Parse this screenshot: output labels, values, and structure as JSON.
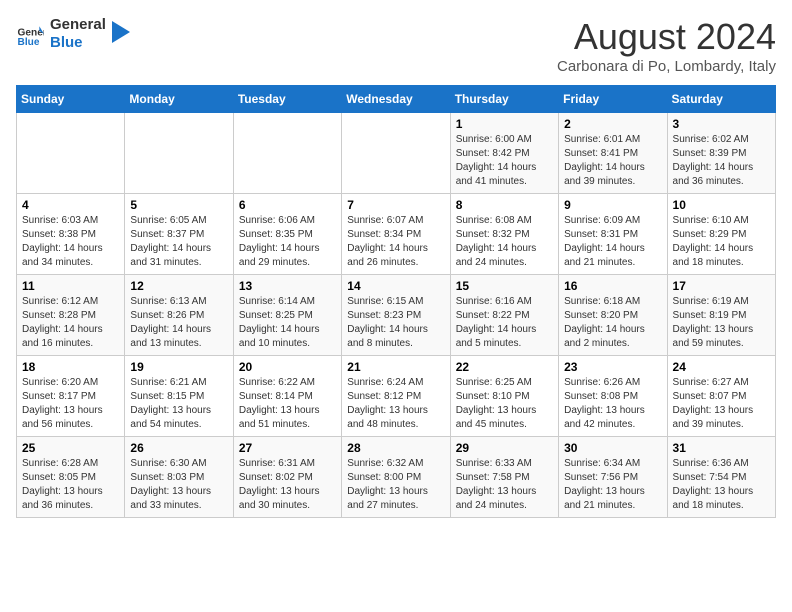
{
  "header": {
    "logo_line1": "General",
    "logo_line2": "Blue",
    "title": "August 2024",
    "subtitle": "Carbonara di Po, Lombardy, Italy"
  },
  "days_of_week": [
    "Sunday",
    "Monday",
    "Tuesday",
    "Wednesday",
    "Thursday",
    "Friday",
    "Saturday"
  ],
  "weeks": [
    [
      {
        "day": "",
        "info": ""
      },
      {
        "day": "",
        "info": ""
      },
      {
        "day": "",
        "info": ""
      },
      {
        "day": "",
        "info": ""
      },
      {
        "day": "1",
        "info": "Sunrise: 6:00 AM\nSunset: 8:42 PM\nDaylight: 14 hours\nand 41 minutes."
      },
      {
        "day": "2",
        "info": "Sunrise: 6:01 AM\nSunset: 8:41 PM\nDaylight: 14 hours\nand 39 minutes."
      },
      {
        "day": "3",
        "info": "Sunrise: 6:02 AM\nSunset: 8:39 PM\nDaylight: 14 hours\nand 36 minutes."
      }
    ],
    [
      {
        "day": "4",
        "info": "Sunrise: 6:03 AM\nSunset: 8:38 PM\nDaylight: 14 hours\nand 34 minutes."
      },
      {
        "day": "5",
        "info": "Sunrise: 6:05 AM\nSunset: 8:37 PM\nDaylight: 14 hours\nand 31 minutes."
      },
      {
        "day": "6",
        "info": "Sunrise: 6:06 AM\nSunset: 8:35 PM\nDaylight: 14 hours\nand 29 minutes."
      },
      {
        "day": "7",
        "info": "Sunrise: 6:07 AM\nSunset: 8:34 PM\nDaylight: 14 hours\nand 26 minutes."
      },
      {
        "day": "8",
        "info": "Sunrise: 6:08 AM\nSunset: 8:32 PM\nDaylight: 14 hours\nand 24 minutes."
      },
      {
        "day": "9",
        "info": "Sunrise: 6:09 AM\nSunset: 8:31 PM\nDaylight: 14 hours\nand 21 minutes."
      },
      {
        "day": "10",
        "info": "Sunrise: 6:10 AM\nSunset: 8:29 PM\nDaylight: 14 hours\nand 18 minutes."
      }
    ],
    [
      {
        "day": "11",
        "info": "Sunrise: 6:12 AM\nSunset: 8:28 PM\nDaylight: 14 hours\nand 16 minutes."
      },
      {
        "day": "12",
        "info": "Sunrise: 6:13 AM\nSunset: 8:26 PM\nDaylight: 14 hours\nand 13 minutes."
      },
      {
        "day": "13",
        "info": "Sunrise: 6:14 AM\nSunset: 8:25 PM\nDaylight: 14 hours\nand 10 minutes."
      },
      {
        "day": "14",
        "info": "Sunrise: 6:15 AM\nSunset: 8:23 PM\nDaylight: 14 hours\nand 8 minutes."
      },
      {
        "day": "15",
        "info": "Sunrise: 6:16 AM\nSunset: 8:22 PM\nDaylight: 14 hours\nand 5 minutes."
      },
      {
        "day": "16",
        "info": "Sunrise: 6:18 AM\nSunset: 8:20 PM\nDaylight: 14 hours\nand 2 minutes."
      },
      {
        "day": "17",
        "info": "Sunrise: 6:19 AM\nSunset: 8:19 PM\nDaylight: 13 hours\nand 59 minutes."
      }
    ],
    [
      {
        "day": "18",
        "info": "Sunrise: 6:20 AM\nSunset: 8:17 PM\nDaylight: 13 hours\nand 56 minutes."
      },
      {
        "day": "19",
        "info": "Sunrise: 6:21 AM\nSunset: 8:15 PM\nDaylight: 13 hours\nand 54 minutes."
      },
      {
        "day": "20",
        "info": "Sunrise: 6:22 AM\nSunset: 8:14 PM\nDaylight: 13 hours\nand 51 minutes."
      },
      {
        "day": "21",
        "info": "Sunrise: 6:24 AM\nSunset: 8:12 PM\nDaylight: 13 hours\nand 48 minutes."
      },
      {
        "day": "22",
        "info": "Sunrise: 6:25 AM\nSunset: 8:10 PM\nDaylight: 13 hours\nand 45 minutes."
      },
      {
        "day": "23",
        "info": "Sunrise: 6:26 AM\nSunset: 8:08 PM\nDaylight: 13 hours\nand 42 minutes."
      },
      {
        "day": "24",
        "info": "Sunrise: 6:27 AM\nSunset: 8:07 PM\nDaylight: 13 hours\nand 39 minutes."
      }
    ],
    [
      {
        "day": "25",
        "info": "Sunrise: 6:28 AM\nSunset: 8:05 PM\nDaylight: 13 hours\nand 36 minutes."
      },
      {
        "day": "26",
        "info": "Sunrise: 6:30 AM\nSunset: 8:03 PM\nDaylight: 13 hours\nand 33 minutes."
      },
      {
        "day": "27",
        "info": "Sunrise: 6:31 AM\nSunset: 8:02 PM\nDaylight: 13 hours\nand 30 minutes."
      },
      {
        "day": "28",
        "info": "Sunrise: 6:32 AM\nSunset: 8:00 PM\nDaylight: 13 hours\nand 27 minutes."
      },
      {
        "day": "29",
        "info": "Sunrise: 6:33 AM\nSunset: 7:58 PM\nDaylight: 13 hours\nand 24 minutes."
      },
      {
        "day": "30",
        "info": "Sunrise: 6:34 AM\nSunset: 7:56 PM\nDaylight: 13 hours\nand 21 minutes."
      },
      {
        "day": "31",
        "info": "Sunrise: 6:36 AM\nSunset: 7:54 PM\nDaylight: 13 hours\nand 18 minutes."
      }
    ]
  ]
}
